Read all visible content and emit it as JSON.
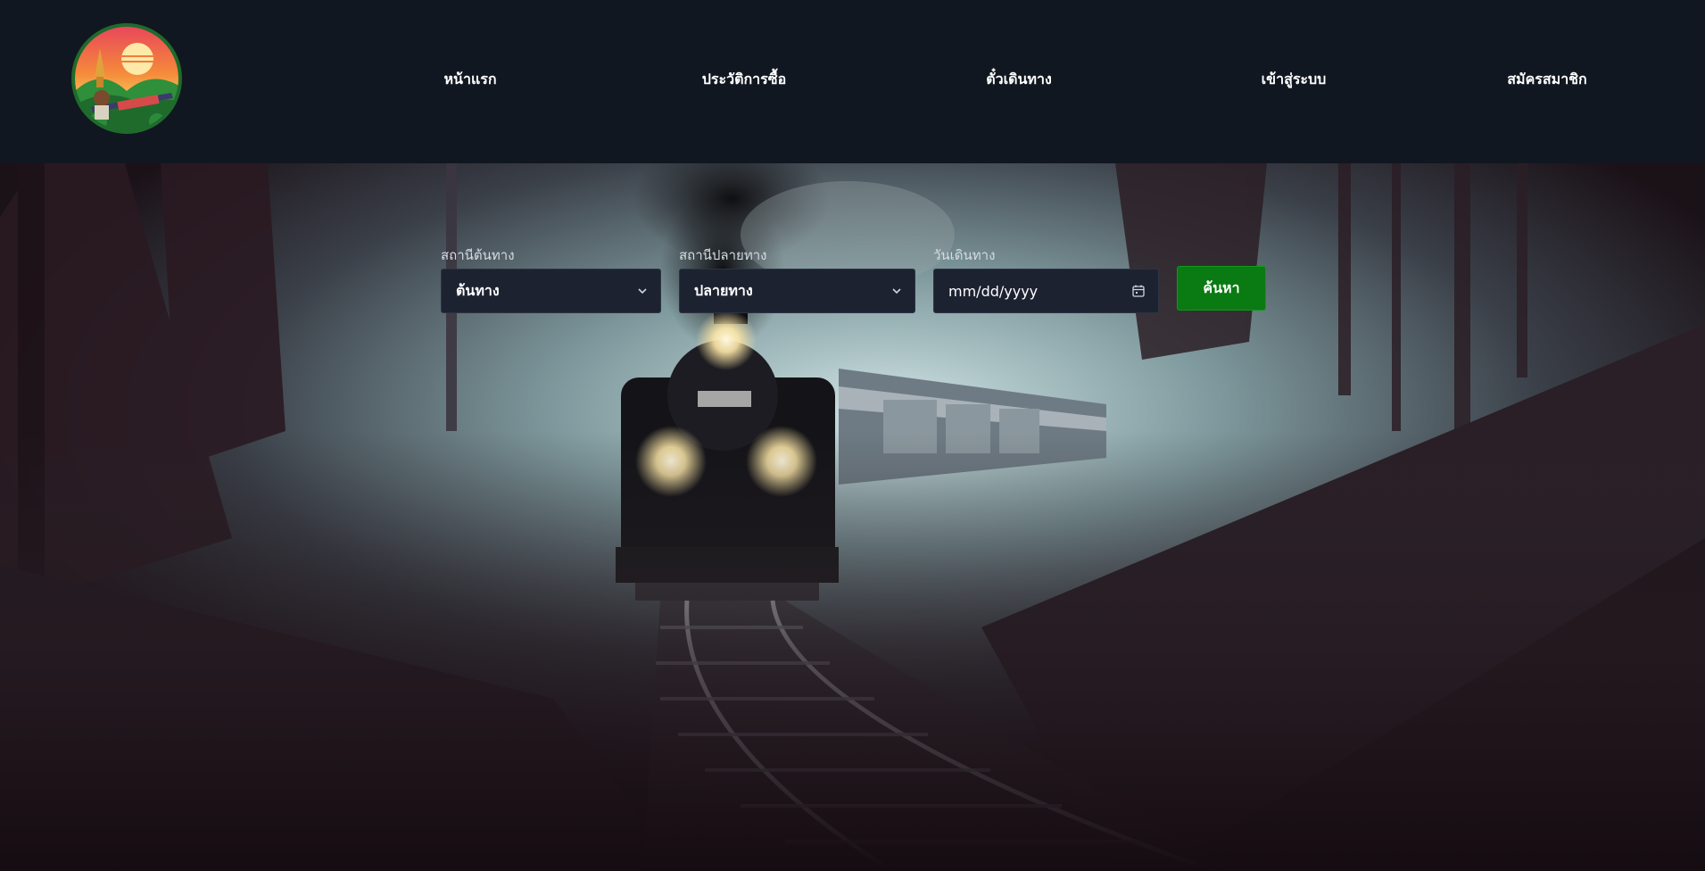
{
  "nav": {
    "logo_icon": "train-sunset-logo-icon",
    "items": [
      {
        "label": "หน้าแรก"
      },
      {
        "label": "ประวัติการซื้อ"
      },
      {
        "label": "ตั๋วเดินทาง"
      },
      {
        "label": "เข้าสู่ระบบ"
      },
      {
        "label": "สมัครสมาชิก"
      }
    ]
  },
  "search": {
    "origin": {
      "label": "สถานีต้นทาง",
      "value": "ต้นทาง",
      "icon": "chevron-down-icon"
    },
    "destination": {
      "label": "สถานีปลายทาง",
      "value": "ปลายทาง",
      "icon": "chevron-down-icon"
    },
    "date": {
      "label": "วันเดินทาง",
      "placeholder": "mm/dd/yyyy",
      "icon": "calendar-icon"
    },
    "button_label": "ค้นหา"
  },
  "colors": {
    "header_bg": "#111720",
    "field_bg": "#1c2230",
    "button_bg": "#0a7a12"
  },
  "hero": {
    "image": "steam-train-in-misty-forest"
  }
}
